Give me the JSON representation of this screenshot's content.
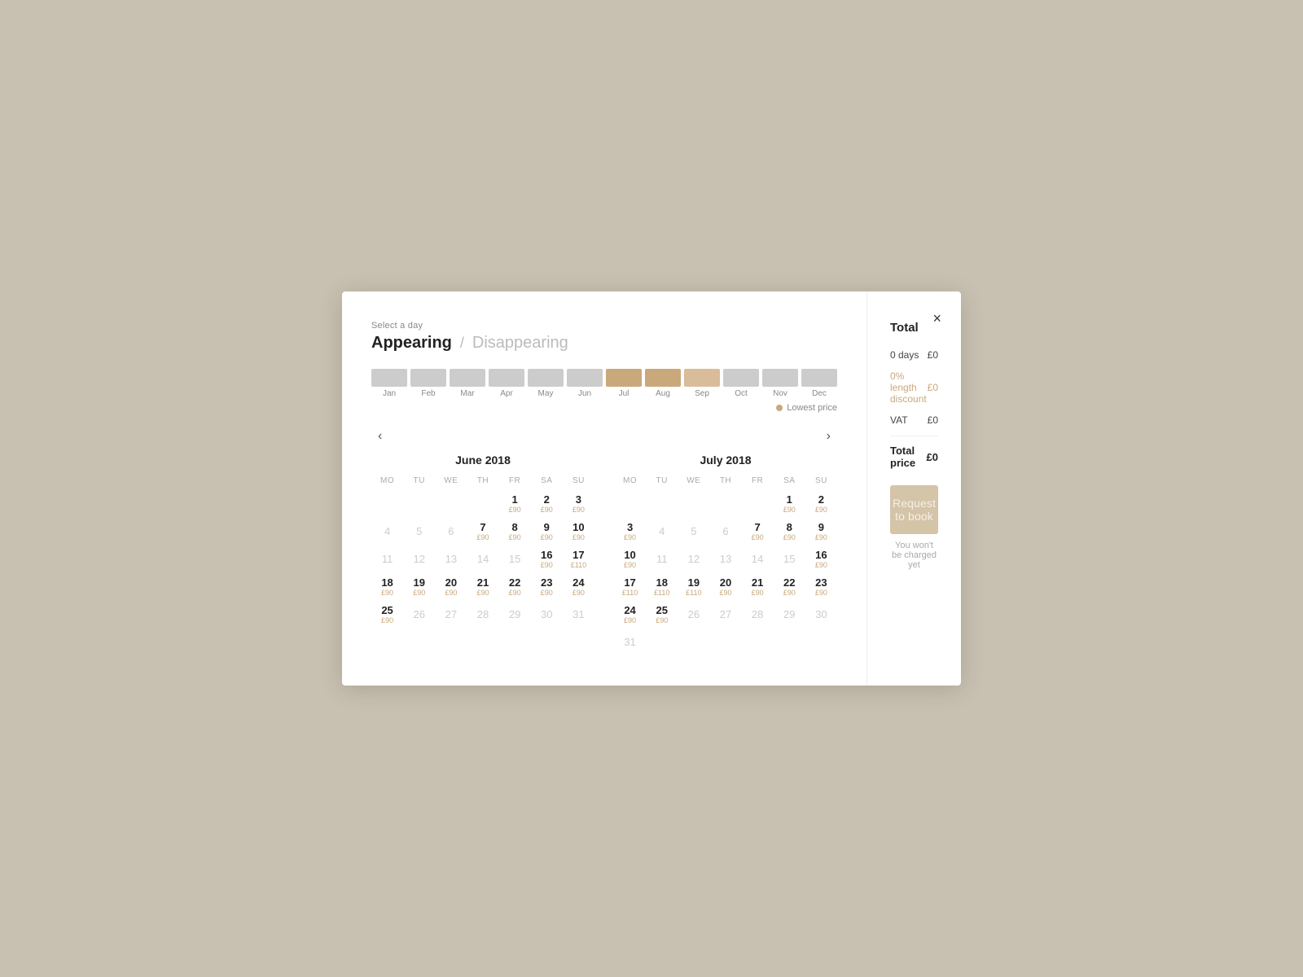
{
  "modal": {
    "close_label": "×",
    "select_day": "Select a day",
    "tab_active": "Appearing",
    "tab_separator": "/",
    "tab_inactive": "Disappearing",
    "lowest_price_label": "Lowest price"
  },
  "month_bar": {
    "months": [
      {
        "label": "Jan",
        "type": "gray"
      },
      {
        "label": "Feb",
        "type": "gray"
      },
      {
        "label": "Mar",
        "type": "gray"
      },
      {
        "label": "Apr",
        "type": "gray"
      },
      {
        "label": "May",
        "type": "gray"
      },
      {
        "label": "Jun",
        "type": "gray"
      },
      {
        "label": "Jul",
        "type": "tan"
      },
      {
        "label": "Aug",
        "type": "tan"
      },
      {
        "label": "Sep",
        "type": "light-tan"
      },
      {
        "label": "Oct",
        "type": "gray"
      },
      {
        "label": "Nov",
        "type": "gray"
      },
      {
        "label": "Dec",
        "type": "gray"
      }
    ]
  },
  "calendars": {
    "prev_label": "‹",
    "next_label": "›",
    "june": {
      "title": "June 2018",
      "headers": [
        "MO",
        "TU",
        "WE",
        "TH",
        "FR",
        "SA",
        "SU"
      ],
      "weeks": [
        [
          {
            "day": "",
            "price": ""
          },
          {
            "day": "",
            "price": ""
          },
          {
            "day": "",
            "price": ""
          },
          {
            "day": "",
            "price": ""
          },
          {
            "day": "1",
            "price": "£90",
            "bold": true
          },
          {
            "day": "2",
            "price": "£90",
            "bold": true
          },
          {
            "day": "3",
            "price": "£90",
            "bold": true
          }
        ],
        [
          {
            "day": "4",
            "price": "",
            "bold": false
          },
          {
            "day": "5",
            "price": "",
            "bold": false
          },
          {
            "day": "6",
            "price": "",
            "bold": false
          },
          {
            "day": "7",
            "price": "£90",
            "bold": true
          },
          {
            "day": "8",
            "price": "£90",
            "bold": true
          },
          {
            "day": "9",
            "price": "£90",
            "bold": true
          },
          {
            "day": "10",
            "price": "£90",
            "bold": true
          }
        ],
        [
          {
            "day": "11",
            "price": "",
            "bold": false
          },
          {
            "day": "12",
            "price": "",
            "bold": false
          },
          {
            "day": "13",
            "price": "",
            "bold": false
          },
          {
            "day": "14",
            "price": "",
            "bold": false
          },
          {
            "day": "15",
            "price": "",
            "bold": false
          },
          {
            "day": "16",
            "price": "£90",
            "bold": true
          },
          {
            "day": "17",
            "price": "£110",
            "bold": true
          }
        ],
        [
          {
            "day": "18",
            "price": "£90",
            "bold": true
          },
          {
            "day": "19",
            "price": "£90",
            "bold": true
          },
          {
            "day": "20",
            "price": "£90",
            "bold": true
          },
          {
            "day": "21",
            "price": "£90",
            "bold": true
          },
          {
            "day": "22",
            "price": "£90",
            "bold": true
          },
          {
            "day": "23",
            "price": "£90",
            "bold": true
          },
          {
            "day": "24",
            "price": "£90",
            "bold": true
          }
        ],
        [
          {
            "day": "25",
            "price": "£90",
            "bold": true
          },
          {
            "day": "26",
            "price": "",
            "bold": false
          },
          {
            "day": "27",
            "price": "",
            "bold": false
          },
          {
            "day": "28",
            "price": "",
            "bold": false
          },
          {
            "day": "29",
            "price": "",
            "bold": false
          },
          {
            "day": "30",
            "price": "",
            "bold": false
          },
          {
            "day": "31",
            "price": "",
            "bold": false
          }
        ]
      ]
    },
    "july": {
      "title": "July 2018",
      "headers": [
        "MO",
        "TU",
        "WE",
        "TH",
        "FR",
        "SA",
        "SU"
      ],
      "weeks": [
        [
          {
            "day": "",
            "price": ""
          },
          {
            "day": "",
            "price": ""
          },
          {
            "day": "",
            "price": ""
          },
          {
            "day": "",
            "price": ""
          },
          {
            "day": "",
            "price": ""
          },
          {
            "day": "1",
            "price": "£90",
            "bold": true
          },
          {
            "day": "2",
            "price": "£90",
            "bold": true
          }
        ],
        [
          {
            "day": "3",
            "price": "£90",
            "bold": true
          },
          {
            "day": "4",
            "price": "",
            "bold": false
          },
          {
            "day": "5",
            "price": "",
            "bold": false
          },
          {
            "day": "6",
            "price": "",
            "bold": false
          },
          {
            "day": "7",
            "price": "£90",
            "bold": true
          },
          {
            "day": "8",
            "price": "£90",
            "bold": true
          },
          {
            "day": "9",
            "price": "£90",
            "bold": true
          }
        ],
        [
          {
            "day": "10",
            "price": "£90",
            "bold": true
          },
          {
            "day": "11",
            "price": "",
            "bold": false
          },
          {
            "day": "12",
            "price": "",
            "bold": false
          },
          {
            "day": "13",
            "price": "",
            "bold": false
          },
          {
            "day": "14",
            "price": "",
            "bold": false
          },
          {
            "day": "15",
            "price": "",
            "bold": false
          },
          {
            "day": "16",
            "price": "£90",
            "bold": true
          }
        ],
        [
          {
            "day": "17",
            "price": "£110",
            "bold": true
          },
          {
            "day": "18",
            "price": "£110",
            "bold": true
          },
          {
            "day": "19",
            "price": "£110",
            "bold": true
          },
          {
            "day": "20",
            "price": "£90",
            "bold": true
          },
          {
            "day": "21",
            "price": "£90",
            "bold": true
          },
          {
            "day": "22",
            "price": "£90",
            "bold": true
          },
          {
            "day": "23",
            "price": "£90",
            "bold": true
          }
        ],
        [
          {
            "day": "24",
            "price": "£90",
            "bold": true
          },
          {
            "day": "25",
            "price": "£90",
            "bold": true
          },
          {
            "day": "26",
            "price": "",
            "bold": false
          },
          {
            "day": "27",
            "price": "",
            "bold": false
          },
          {
            "day": "28",
            "price": "",
            "bold": false
          },
          {
            "day": "29",
            "price": "",
            "bold": false
          },
          {
            "day": "30",
            "price": "",
            "bold": false
          }
        ],
        [
          {
            "day": "31",
            "price": "",
            "bold": false
          },
          {
            "day": "",
            "price": ""
          },
          {
            "day": "",
            "price": ""
          },
          {
            "day": "",
            "price": ""
          },
          {
            "day": "",
            "price": ""
          },
          {
            "day": "",
            "price": ""
          },
          {
            "day": "",
            "price": ""
          }
        ]
      ]
    }
  },
  "pricing": {
    "total_label": "Total",
    "days_label": "0 days",
    "days_value": "£0",
    "discount_label": "0% length discount",
    "discount_value": "£0",
    "vat_label": "VAT",
    "vat_value": "£0",
    "total_price_label": "Total price",
    "total_price_value": "£0",
    "request_button": "Request to book",
    "not_charged_text": "You won't be charged yet"
  }
}
